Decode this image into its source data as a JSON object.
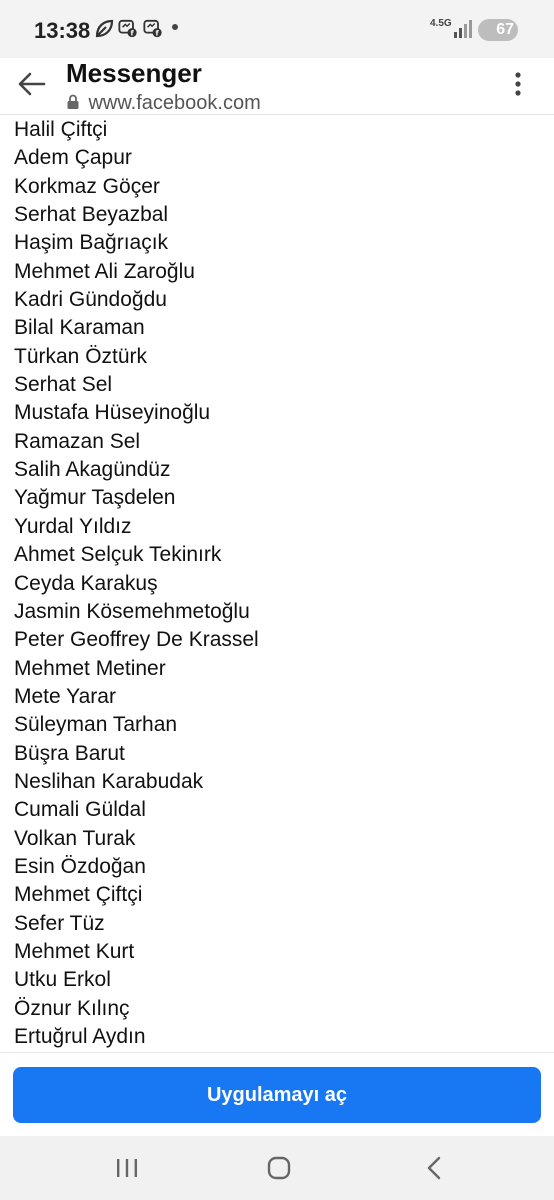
{
  "status_bar": {
    "time": "13:38",
    "network_label": "4.5G",
    "battery": "67",
    "icons": [
      "leaf-icon",
      "messenger-notification-icon",
      "facebook-notification-icon",
      "signal-icon"
    ]
  },
  "header": {
    "title": "Messenger",
    "url": "www.facebook.com",
    "back_icon": "arrow-left-icon",
    "more_icon": "more-vertical-icon"
  },
  "names": [
    "Halil Çiftçi",
    "Adem Çapur",
    "Korkmaz Göçer",
    "Serhat Beyazbal",
    "Haşim Bağrıaçık",
    "Mehmet Ali Zaroğlu",
    "Kadri Gündoğdu",
    "Bilal Karaman",
    "Türkan Öztürk",
    "Serhat Sel",
    "Mustafa Hüseyinoğlu",
    "Ramazan Sel",
    "Salih Akagündüz",
    "Yağmur Taşdelen",
    "Yurdal Yıldız",
    "Ahmet Selçuk Tekinırk",
    "Ceyda Karakuş",
    "Jasmin Kösemehmetoğlu",
    "Peter Geoffrey De Krassel",
    "Mehmet Metiner",
    "Mete Yarar",
    "Süleyman Tarhan",
    "Büşra Barut",
    "Neslihan Karabudak",
    "Cumali Güldal",
    "Volkan Turak",
    "Esin Özdoğan",
    "Mehmet Çiftçi",
    "Sefer Tüz",
    "Mehmet Kurt",
    "Utku Erkol",
    "Öznur Kılınç",
    "Ertuğrul Aydın"
  ],
  "open_app_button": "Uygulamayı aç",
  "colors": {
    "accent": "#1877f2",
    "status_bar_bg": "#f3f3f3",
    "nav_bar_bg": "#f1f1f1"
  },
  "nav_bar": {
    "items": [
      "recent-apps-icon",
      "home-icon",
      "back-nav-icon"
    ]
  }
}
